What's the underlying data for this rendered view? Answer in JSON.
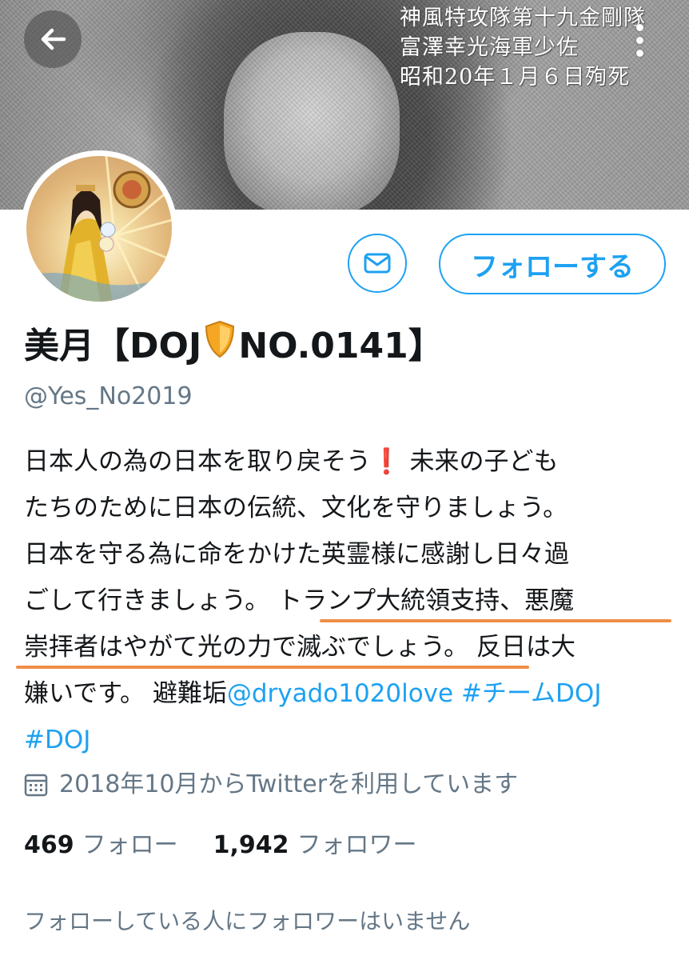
{
  "banner": {
    "caption_lines": [
      "神風特攻隊第十九金剛隊",
      "富澤幸光海軍少佐",
      "昭和20年１月６日殉死"
    ]
  },
  "header": {
    "back_icon": "arrow-left-icon",
    "more_icon": "more-vertical-icon"
  },
  "profile": {
    "name_prefix": "美月【DOJ",
    "name_suffix": "NO.0141】",
    "badge_icon": "shield-icon",
    "handle": "@Yes_No2019",
    "follow_label": "フォローする",
    "dm_icon": "mail-icon",
    "bio": {
      "line1_text": "日本人の為の日本を取り戻そう",
      "line1_emoji": "❗",
      "line1_rest": " 未来の子ども",
      "line2": "たちのために日本の伝統、文化を守りましょう。",
      "line3": "日本を守る為に命をかけた英霊様に感謝し日々過",
      "line4_a": "ごして行きましょう。",
      "line4_b": "トランプ大統領支持、悪魔",
      "line5_a": "崇拝者はやがて光の力で滅ぶでしょう。",
      "line5_b": " 反日は大",
      "line6_a": "嫌いです。 避難垢",
      "line6_link1": "@dryado1020love",
      "line6_link2": "#チームDOJ",
      "line7_link": "#DOJ"
    },
    "joined": "2018年10月からTwitterを利用しています",
    "calendar_icon": "calendar-icon",
    "following_count": "469",
    "following_label": "フォロー",
    "followers_count": "1,942",
    "followers_label": "フォロワー",
    "mutual_notice": "フォローしている人にフォロワーはいません"
  },
  "colors": {
    "accent": "#1da1f2",
    "secondary_text": "#657786",
    "annotation_underline": "#ef8e48"
  }
}
